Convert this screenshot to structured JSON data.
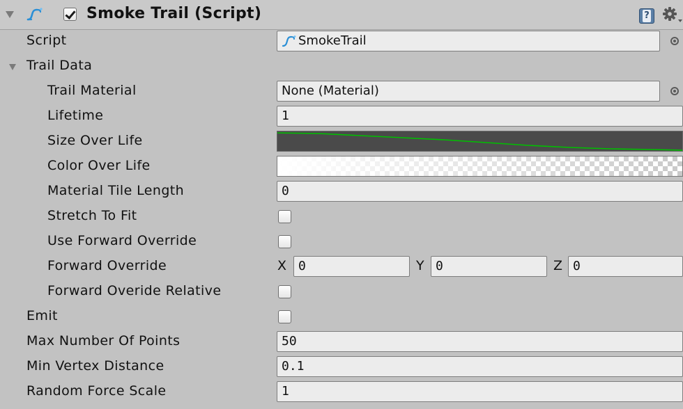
{
  "header": {
    "title": "Smoke Trail (Script)",
    "enabled": true,
    "icons": {
      "foldout": "triangle-down-icon",
      "script": "script-icon",
      "help": "help-book-icon",
      "settings": "gear-icon"
    }
  },
  "script_row": {
    "label": "Script",
    "value": "SmokeTrail"
  },
  "trail_data": {
    "label": "Trail Data",
    "expanded": true,
    "trail_material": {
      "label": "Trail Material",
      "value": "None (Material)"
    },
    "lifetime": {
      "label": "Lifetime",
      "value": "1"
    },
    "size_over_life": {
      "label": "Size Over Life",
      "curve_color": "#00c000"
    },
    "color_over_life": {
      "label": "Color Over Life"
    },
    "material_tile_length": {
      "label": "Material Tile Length",
      "value": "0"
    },
    "stretch_to_fit": {
      "label": "Stretch To Fit",
      "checked": false
    },
    "use_forward_override": {
      "label": "Use Forward Override",
      "checked": false
    },
    "forward_override": {
      "label": "Forward Override",
      "x_label": "X",
      "x": "0",
      "y_label": "Y",
      "y": "0",
      "z_label": "Z",
      "z": "0"
    },
    "forward_override_relative": {
      "label": "Forward Overide Relative",
      "checked": false
    }
  },
  "emit": {
    "label": "Emit",
    "checked": false
  },
  "max_number_of_points": {
    "label": "Max Number Of Points",
    "value": "50"
  },
  "min_vertex_distance": {
    "label": "Min Vertex Distance",
    "value": "0.1"
  },
  "random_force_scale": {
    "label": "Random Force Scale",
    "value": "1"
  }
}
